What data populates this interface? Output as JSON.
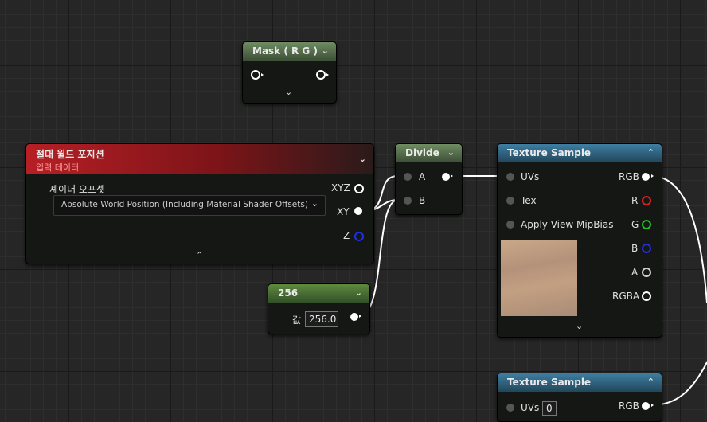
{
  "mask_node": {
    "title": "Mask ( R G )"
  },
  "world_node": {
    "title": "절대 월드 포지션",
    "subtitle": "입력 데이터",
    "field_label": "셰이더 오프셋",
    "dropdown_value": "Absolute World Position (Including Material Shader Offsets)",
    "outputs": [
      "XYZ",
      "XY",
      "Z"
    ]
  },
  "divide_node": {
    "title": "Divide",
    "inputs": [
      "A",
      "B"
    ]
  },
  "const_node": {
    "title": "256",
    "value_label": "값",
    "value": "256.0"
  },
  "texture_node_1": {
    "title": "Texture Sample",
    "inputs": [
      "UVs",
      "Tex",
      "Apply View MipBias"
    ],
    "outputs": [
      "RGB",
      "R",
      "G",
      "B",
      "A",
      "RGBA"
    ]
  },
  "texture_node_2": {
    "title": "Texture Sample",
    "input": "UVs",
    "uv_value": "0",
    "output": "RGB"
  },
  "colors": {
    "red": "#e02020",
    "green": "#20c020",
    "blue": "#2030e0",
    "wire": "#ffffff"
  }
}
